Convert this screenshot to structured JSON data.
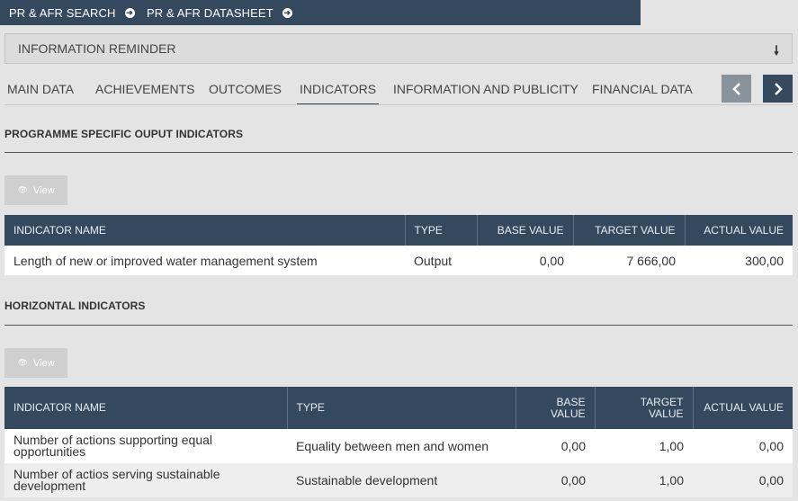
{
  "topbar": {
    "links": [
      "PR & AFR SEARCH",
      "PR & AFR DATASHEET"
    ]
  },
  "reminder": {
    "label": "INFORMATION REMINDER"
  },
  "tabs": {
    "items": [
      "MAIN DATA",
      "ACHIEVEMENTS",
      "OUTCOMES",
      "INDICATORS",
      "INFORMATION AND PUBLICITY",
      "FINANCIAL DATA"
    ],
    "active": "INDICATORS",
    "prev_icon": "chevron-left-icon",
    "next_icon": "chevron-right-icon"
  },
  "programme": {
    "title": "PROGRAMME SPECIFIC OUPUT INDICATORS",
    "view_label": "View",
    "columns": [
      "INDICATOR NAME",
      "TYPE",
      "BASE VALUE",
      "TARGET VALUE",
      "ACTUAL VALUE"
    ],
    "rows": [
      {
        "name": "Length of new or improved water management system",
        "type": "Output",
        "base": "0,00",
        "target": "7 666,00",
        "actual": "300,00"
      }
    ]
  },
  "horizontal": {
    "title": "HORIZONTAL INDICATORS",
    "view_label": "View",
    "columns": [
      "INDICATOR NAME",
      "TYPE",
      "BASE VALUE",
      "TARGET VALUE",
      "ACTUAL VALUE"
    ],
    "rows": [
      {
        "name": "Number of actions supporting equal opportunities",
        "type": "Equality between men and women",
        "base": "0,00",
        "target": "1,00",
        "actual": "0,00"
      },
      {
        "name": "Number of actios serving sustainable development",
        "type": "Sustainable development",
        "base": "0,00",
        "target": "1,00",
        "actual": "0,00"
      }
    ]
  },
  "colors": {
    "header": "#34495e",
    "background": "#e4e4e4",
    "nav_prev": "#8a939c"
  }
}
